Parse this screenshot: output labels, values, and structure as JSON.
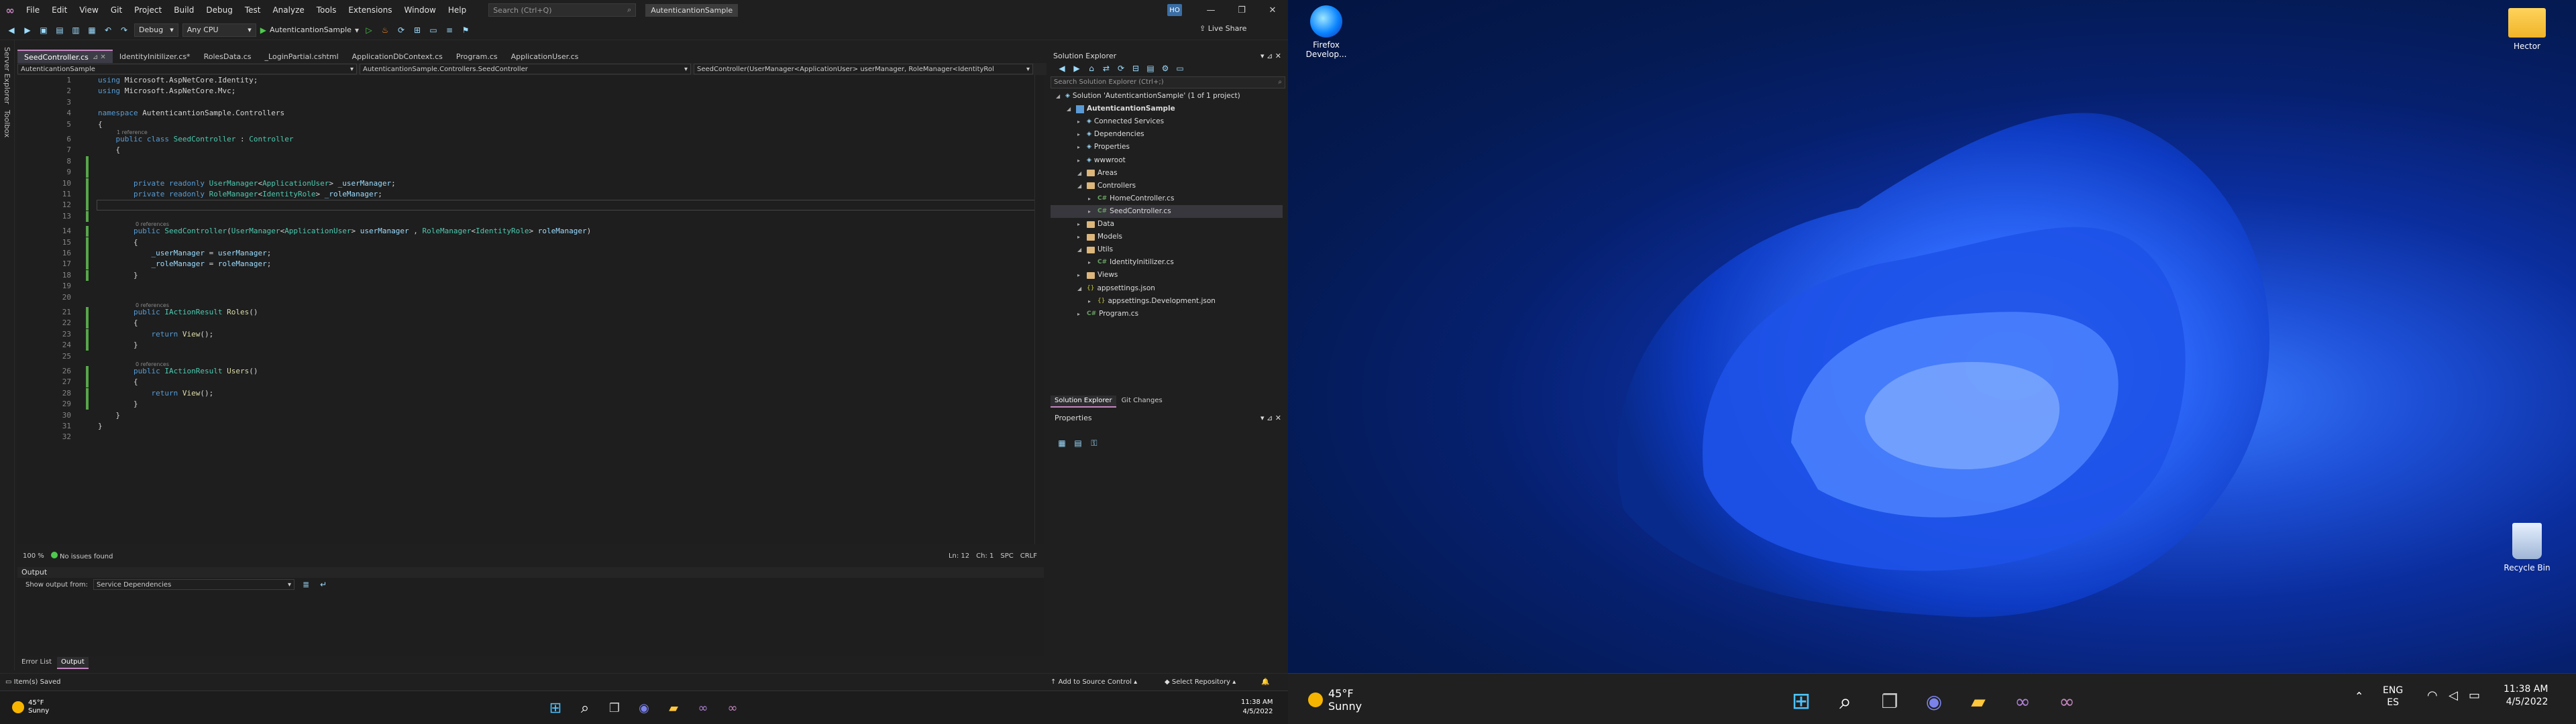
{
  "vs": {
    "menu": [
      "File",
      "Edit",
      "View",
      "Git",
      "Project",
      "Build",
      "Debug",
      "Test",
      "Analyze",
      "Tools",
      "Extensions",
      "Window",
      "Help"
    ],
    "search_placeholder": "Search (Ctrl+Q)",
    "solution_badge": "AutenticantionSample",
    "user_initials": "HO",
    "window_controls": [
      "—",
      "❐",
      "✕"
    ],
    "toolbar": {
      "config": "Debug",
      "platform": "Any CPU",
      "run_label": "AutenticantionSample",
      "live_share": "Live Share"
    },
    "side_tools": [
      "Server Explorer",
      "Toolbox"
    ],
    "tabs": [
      {
        "label": "SeedController.cs",
        "active": true
      },
      {
        "label": "IdentityInitilizer.cs*",
        "active": false
      },
      {
        "label": "RolesData.cs",
        "active": false
      },
      {
        "label": "_LoginPartial.cshtml",
        "active": false
      },
      {
        "label": "ApplicationDbContext.cs",
        "active": false
      },
      {
        "label": "Program.cs",
        "active": false
      },
      {
        "label": "ApplicationUser.cs",
        "active": false
      }
    ],
    "nav": {
      "project": "AutenticantionSample",
      "class": "AutenticantionSample.Controllers.SeedController",
      "member": "SeedController(UserManager<ApplicationUser> userManager, RoleManager<IdentityRol"
    },
    "code_lines": [
      {
        "n": "1",
        "text": "using Microsoft.AspNetCore.Identity;"
      },
      {
        "n": "2",
        "text": "using Microsoft.AspNetCore.Mvc;"
      },
      {
        "n": "3",
        "text": ""
      },
      {
        "n": "4",
        "text": "namespace AutenticantionSample.Controllers"
      },
      {
        "n": "5",
        "text": "{"
      },
      {
        "n": "6",
        "text": "    public class SeedController : Controller"
      },
      {
        "n": "7",
        "text": "    {"
      },
      {
        "n": "8",
        "text": ""
      },
      {
        "n": "9",
        "text": ""
      },
      {
        "n": "10",
        "text": "        private readonly UserManager<ApplicationUser> _userManager;"
      },
      {
        "n": "11",
        "text": "        private readonly RoleManager<IdentityRole> _roleManager;"
      },
      {
        "n": "12",
        "text": ""
      },
      {
        "n": "13",
        "text": ""
      },
      {
        "n": "14",
        "text": "        public SeedController(UserManager<ApplicationUser> userManager , RoleManager<IdentityRole> roleManager)"
      },
      {
        "n": "15",
        "text": "        {"
      },
      {
        "n": "16",
        "text": "            _userManager = userManager;"
      },
      {
        "n": "17",
        "text": "            _roleManager = roleManager;"
      },
      {
        "n": "18",
        "text": "        }"
      },
      {
        "n": "19",
        "text": ""
      },
      {
        "n": "20",
        "text": ""
      },
      {
        "n": "21",
        "text": "        public IActionResult Roles()"
      },
      {
        "n": "22",
        "text": "        {"
      },
      {
        "n": "23",
        "text": "            return View();"
      },
      {
        "n": "24",
        "text": "        }"
      },
      {
        "n": "25",
        "text": ""
      },
      {
        "n": "26",
        "text": "        public IActionResult Users()"
      },
      {
        "n": "27",
        "text": "        {"
      },
      {
        "n": "28",
        "text": "            return View();"
      },
      {
        "n": "29",
        "text": "        }"
      },
      {
        "n": "30",
        "text": "    }"
      },
      {
        "n": "31",
        "text": "}"
      },
      {
        "n": "32",
        "text": ""
      }
    ],
    "codelens": [
      "1 reference",
      "0 references",
      "0 references",
      "0 references"
    ],
    "editor_status": {
      "zoom": "100 %",
      "issues": "No issues found",
      "ln": "Ln: 12",
      "ch": "Ch: 1",
      "spc": "SPC",
      "crlf": "CRLF"
    },
    "output": {
      "title": "Output",
      "show_from_label": "Show output from:",
      "source": "Service Dependencies"
    },
    "bottom_tabs": [
      "Error List",
      "Output"
    ],
    "status": {
      "message": "Item(s) Saved",
      "source_control": "Add to Source Control",
      "repo": "Select Repository"
    },
    "solution_explorer": {
      "title": "Solution Explorer",
      "search_placeholder": "Search Solution Explorer (Ctrl+;)",
      "tree": [
        {
          "label": "Solution 'AutenticantionSample' (1 of 1 project)",
          "indent": 0,
          "icon": "solution"
        },
        {
          "label": "AutenticantionSample",
          "indent": 1,
          "icon": "project",
          "bold": true
        },
        {
          "label": "Connected Services",
          "indent": 2,
          "icon": "service"
        },
        {
          "label": "Dependencies",
          "indent": 2,
          "icon": "deps"
        },
        {
          "label": "Properties",
          "indent": 2,
          "icon": "props"
        },
        {
          "label": "wwwroot",
          "indent": 2,
          "icon": "globe"
        },
        {
          "label": "Areas",
          "indent": 2,
          "icon": "folder"
        },
        {
          "label": "Controllers",
          "indent": 2,
          "icon": "folder"
        },
        {
          "label": "HomeController.cs",
          "indent": 3,
          "icon": "cs"
        },
        {
          "label": "SeedController.cs",
          "indent": 3,
          "icon": "cs",
          "selected": true
        },
        {
          "label": "Data",
          "indent": 2,
          "icon": "folder"
        },
        {
          "label": "Models",
          "indent": 2,
          "icon": "folder"
        },
        {
          "label": "Utils",
          "indent": 2,
          "icon": "folder"
        },
        {
          "label": "IdentityInitilizer.cs",
          "indent": 3,
          "icon": "cs"
        },
        {
          "label": "Views",
          "indent": 2,
          "icon": "folder"
        },
        {
          "label": "appsettings.json",
          "indent": 2,
          "icon": "json"
        },
        {
          "label": "appsettings.Development.json",
          "indent": 3,
          "icon": "json"
        },
        {
          "label": "Program.cs",
          "indent": 2,
          "icon": "cs"
        }
      ],
      "tabs": [
        "Solution Explorer",
        "Git Changes"
      ]
    },
    "properties": {
      "title": "Properties"
    }
  },
  "desktop": {
    "icons": [
      {
        "label": "Firefox Develop...",
        "name": "firefox-developer-icon"
      },
      {
        "label": "Hector",
        "name": "hector-folder-icon"
      },
      {
        "label": "Recycle Bin",
        "name": "recycle-bin-icon"
      }
    ]
  },
  "taskbar_left": {
    "weather_temp": "45°F",
    "weather_text": "Sunny",
    "time": "11:38 AM",
    "date": "4/5/2022"
  },
  "taskbar_right": {
    "weather_temp": "45°F",
    "weather_text": "Sunny",
    "lang_top": "ENG",
    "lang_bottom": "ES",
    "time": "11:38 AM",
    "date": "4/5/2022"
  }
}
